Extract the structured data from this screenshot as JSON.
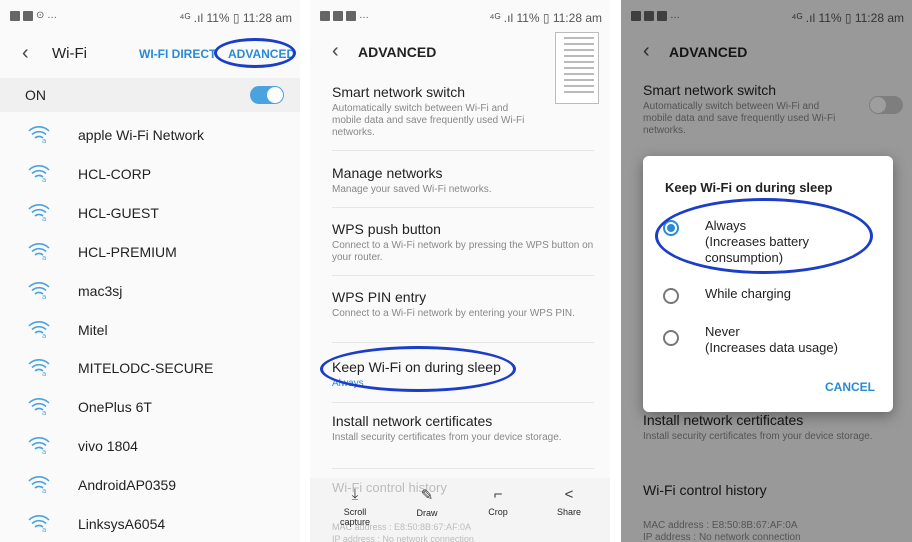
{
  "status": {
    "time_left_panel": "11:28 am",
    "battery": "11%",
    "network": "4G",
    "panel1_right": "⁴ᴳ .ıl 11% ▯ 11:28 am",
    "panel2_right": "⁴ᴳ .ıl 11% ▯ 11:28 am",
    "panel3_right": "⁴ᴳ .ıl 11% ▯ 11:28 am"
  },
  "panel1": {
    "title": "Wi-Fi",
    "wifi_direct": "WI-FI DIRECT",
    "advanced": "ADVANCED",
    "on_label": "ON",
    "networks": [
      "apple Wi-Fi Network",
      "HCL-CORP",
      "HCL-GUEST",
      "HCL-PREMIUM",
      "mac3sj",
      "Mitel",
      "MITELODC-SECURE",
      "OnePlus 6T",
      "vivo 1804",
      "AndroidAP0359",
      "LinksysA6054"
    ]
  },
  "panel2": {
    "title": "ADVANCED",
    "items": [
      {
        "title": "Smart network switch",
        "desc": "Automatically switch between Wi-Fi and mobile data and save frequently used Wi-Fi networks."
      },
      {
        "title": "Manage networks",
        "desc": "Manage your saved Wi-Fi networks."
      },
      {
        "title": "WPS push button",
        "desc": "Connect to a Wi-Fi network by pressing the WPS button on your router."
      },
      {
        "title": "WPS PIN entry",
        "desc": "Connect to a Wi-Fi network by entering your WPS PIN."
      },
      {
        "title": "Keep Wi-Fi on during sleep",
        "value": "Always"
      },
      {
        "title": "Install network certificates",
        "desc": "Install security certificates from your device storage."
      }
    ],
    "faded_item": "Wi-Fi control history",
    "faded_mac": "MAC address : E8:50:8B:67:AF:0A",
    "faded_ip": "IP address : No network connection",
    "toolbar": {
      "scroll": "Scroll capture",
      "draw": "Draw",
      "crop": "Crop",
      "share": "Share"
    }
  },
  "panel3": {
    "title": "ADVANCED",
    "smart_switch_title": "Smart network switch",
    "smart_switch_desc": "Automatically switch between Wi-Fi and mobile data and save frequently used Wi-Fi networks.",
    "install_title": "Install network certificates",
    "install_desc": "Install security certificates from your device storage.",
    "history_title": "Wi-Fi control history",
    "mac": "MAC address : E8:50:8B:67:AF:0A",
    "ip": "IP address : No network connection",
    "dialog": {
      "title": "Keep Wi-Fi on during sleep",
      "options": [
        {
          "label": "Always",
          "sub": "(Increases battery consumption)",
          "selected": true
        },
        {
          "label": "While charging",
          "sub": "",
          "selected": false
        },
        {
          "label": "Never",
          "sub": "(Increases data usage)",
          "selected": false
        }
      ],
      "cancel": "CANCEL"
    }
  },
  "colors": {
    "accent": "#2a8ad6",
    "annotation": "#1a3ec8"
  }
}
